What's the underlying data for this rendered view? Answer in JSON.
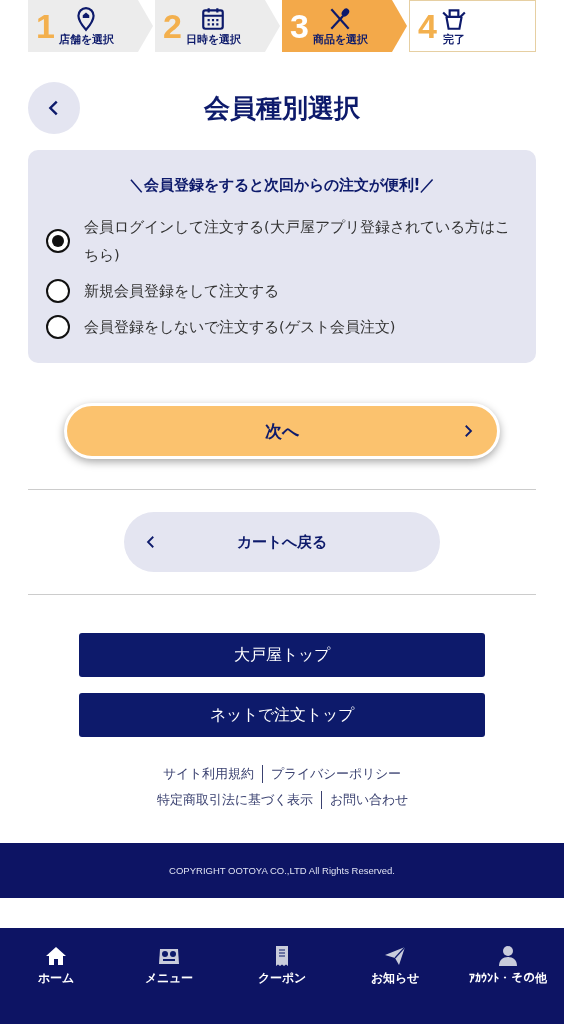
{
  "steps": [
    {
      "number": "1",
      "label": "店舗を選択",
      "completed": true,
      "current": false
    },
    {
      "number": "2",
      "label": "日時を選択",
      "completed": true,
      "current": false
    },
    {
      "number": "3",
      "label": "商品を選択",
      "completed": false,
      "current": true
    },
    {
      "number": "4",
      "label": "完了",
      "completed": false,
      "current": false
    }
  ],
  "header": {
    "title": "会員種別選択"
  },
  "card": {
    "heading": "＼会員登録をすると次回からの注文が便利!／",
    "options": [
      {
        "label": "会員ログインして注文する(大戸屋アプリ登録されている方はこちら)",
        "selected": true
      },
      {
        "label": "新規会員登録をして注文する",
        "selected": false
      },
      {
        "label": "会員登録をしないで注文する(ゲスト会員注文)",
        "selected": false
      }
    ]
  },
  "next_button": "次へ",
  "back_to_cart_button": "カートへ戻る",
  "nav_buttons": [
    "大戸屋トップ",
    "ネットで注文トップ"
  ],
  "footer_links": [
    [
      "サイト利用規約",
      "プライバシーポリシー"
    ],
    [
      "特定商取引法に基づく表示",
      "お問い合わせ"
    ]
  ],
  "copyright": "COPYRIGHT OOTOYA CO.,LTD All Rights Reserved.",
  "tab_bar": [
    {
      "label": "ホーム"
    },
    {
      "label": "メニュー"
    },
    {
      "label": "クーポン"
    },
    {
      "label": "お知らせ"
    },
    {
      "label": "ｱｶｳﾝﾄ・その他"
    }
  ]
}
